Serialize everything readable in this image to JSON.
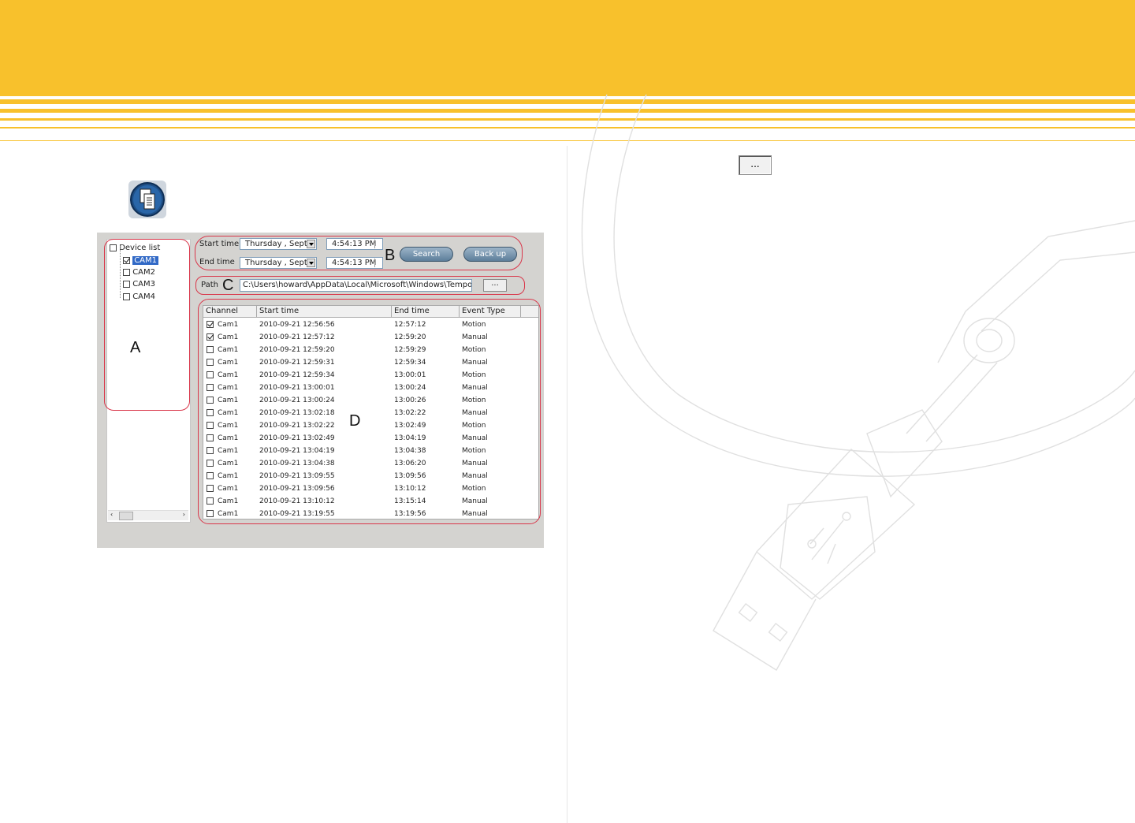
{
  "ellipsis_button": "...",
  "app": {
    "tree": {
      "root": {
        "label": "Device list",
        "checked": false
      },
      "items": [
        {
          "label": "CAM1",
          "checked": true,
          "selected": true
        },
        {
          "label": "CAM2",
          "checked": false,
          "selected": false
        },
        {
          "label": "CAM3",
          "checked": false,
          "selected": false
        },
        {
          "label": "CAM4",
          "checked": false,
          "selected": false
        }
      ]
    },
    "search": {
      "start_label": "Start time",
      "start_date": "Thursday  , Sept",
      "start_time": "4:54:13 PM",
      "end_label": "End time",
      "end_date": "Thursday  , Sept",
      "end_time": "4:54:13 PM",
      "search_button": "Search",
      "backup_button": "Back up"
    },
    "path": {
      "label": "Path",
      "value": "C:\\Users\\howard\\AppData\\Local\\Microsoft\\Windows\\Temporary ...",
      "browse": "..."
    },
    "regions": {
      "a": "A",
      "b": "B",
      "c": "C",
      "d": "D"
    },
    "table": {
      "headers": [
        "Channel",
        "Start time",
        "End time",
        "Event Type"
      ],
      "rows": [
        {
          "checked": true,
          "channel": "Cam1",
          "start": "2010-09-21 12:56:56",
          "end": "12:57:12",
          "type": "Motion"
        },
        {
          "checked": true,
          "channel": "Cam1",
          "start": "2010-09-21 12:57:12",
          "end": "12:59:20",
          "type": "Manual"
        },
        {
          "checked": false,
          "channel": "Cam1",
          "start": "2010-09-21 12:59:20",
          "end": "12:59:29",
          "type": "Motion"
        },
        {
          "checked": false,
          "channel": "Cam1",
          "start": "2010-09-21 12:59:31",
          "end": "12:59:34",
          "type": "Manual"
        },
        {
          "checked": false,
          "channel": "Cam1",
          "start": "2010-09-21 12:59:34",
          "end": "13:00:01",
          "type": "Motion"
        },
        {
          "checked": false,
          "channel": "Cam1",
          "start": "2010-09-21 13:00:01",
          "end": "13:00:24",
          "type": "Manual"
        },
        {
          "checked": false,
          "channel": "Cam1",
          "start": "2010-09-21 13:00:24",
          "end": "13:00:26",
          "type": "Motion"
        },
        {
          "checked": false,
          "channel": "Cam1",
          "start": "2010-09-21 13:02:18",
          "end": "13:02:22",
          "type": "Manual"
        },
        {
          "checked": false,
          "channel": "Cam1",
          "start": "2010-09-21 13:02:22",
          "end": "13:02:49",
          "type": "Motion"
        },
        {
          "checked": false,
          "channel": "Cam1",
          "start": "2010-09-21 13:02:49",
          "end": "13:04:19",
          "type": "Manual"
        },
        {
          "checked": false,
          "channel": "Cam1",
          "start": "2010-09-21 13:04:19",
          "end": "13:04:38",
          "type": "Motion"
        },
        {
          "checked": false,
          "channel": "Cam1",
          "start": "2010-09-21 13:04:38",
          "end": "13:06:20",
          "type": "Manual"
        },
        {
          "checked": false,
          "channel": "Cam1",
          "start": "2010-09-21 13:09:55",
          "end": "13:09:56",
          "type": "Manual"
        },
        {
          "checked": false,
          "channel": "Cam1",
          "start": "2010-09-21 13:09:56",
          "end": "13:10:12",
          "type": "Motion"
        },
        {
          "checked": false,
          "channel": "Cam1",
          "start": "2010-09-21 13:10:12",
          "end": "13:15:14",
          "type": "Manual"
        },
        {
          "checked": false,
          "channel": "Cam1",
          "start": "2010-09-21 13:19:55",
          "end": "13:19:56",
          "type": "Manual"
        }
      ]
    }
  },
  "colors": {
    "header": "#f8c12c",
    "highlight": "#d9364a",
    "selection": "#3169c6"
  }
}
